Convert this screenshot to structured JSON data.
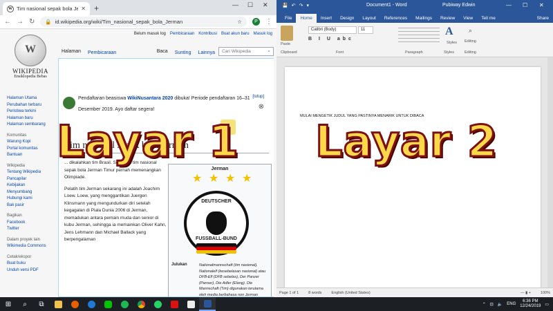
{
  "chrome": {
    "tab_title": "Tim nasional sepak bola Jerman",
    "address": "id.wikipedia.org/wiki/Tim_nasional_sepak_bola_Jerman",
    "avatar_letter": "P"
  },
  "wiki": {
    "wordmark": "WIKIPEDIA",
    "tagline": "Ensiklopedia Bebas",
    "user_links": [
      "Belum masuk log",
      "Pembicaraan",
      "Kontribusi",
      "Buat akun baru",
      "Masuk log"
    ],
    "tabs": [
      "Halaman",
      "Pembicaraan",
      "Baca",
      "Sunting",
      "Lainnya"
    ],
    "search_placeholder": "Cari Wikipedia",
    "sidebar_main": [
      "Halaman Utama",
      "Perubahan terbaru",
      "Peristiwa terkini",
      "Halaman baru",
      "Halaman sembarang"
    ],
    "sidebar_h_community": "Komunitas",
    "sidebar_community": [
      "Warung Kopi",
      "Portal komunitas",
      "Bantuan"
    ],
    "sidebar_h_wikipedia": "Wikipedia",
    "sidebar_wikipedia": [
      "Tentang Wikipedia",
      "Pancapilar",
      "Kebijakan",
      "Menyumbang",
      "Hubungi kami",
      "Bak pasir"
    ],
    "sidebar_h_share": "Bagikan",
    "sidebar_share": [
      "Facebook",
      "Twitter"
    ],
    "sidebar_h_other": "Dalam proyek lain",
    "sidebar_other": [
      "Wikimedia Commons"
    ],
    "sidebar_h_print": "Cetak/ekspor",
    "sidebar_print": [
      "Buat buku",
      "Unduh versi PDF"
    ],
    "notice_close": "[tutup]",
    "notice_pre": "Pendaftaran beasiswa ",
    "notice_bold": "WikiNusantara 2020",
    "notice_post": " dibuka! Periode pendaftaran 16–31 Desember 2019. Ayo daftar segera!",
    "article_title": "Tim nasional sepak bola Jerman",
    "body_p1": "... dikalahkan tim Brasil. Selain itu tim nasional sepak bola Jerman Timur pernah memenangkan Olimpiade.",
    "body_p2": "Pelatih tim Jerman sekarang ini adalah Joachim Loew. Loew, yang menggantikan Juergen Klinsmann yang mengundurkan diri setelah kegagalan di Piala Dunia 2006 di Jerman, memadukan antara pemain muda dan senior di kubu Jerman, sehingga ia memainkan Oliver Kahn, Jens Lehmann dan Michael Ballack yang berpengalaman",
    "infobox_title": "Jerman",
    "crest_top": "DEUTSCHER",
    "crest_bottom": "FUSSBALL-BUND",
    "julukan_key": "Julukan",
    "julukan_value": "Nationalmannschaft (tim nasional), Nationalelf (kesebelasan nasional) atau DFB-Elf (DFB sebelas), Der Panzer (Panser), Die Adler (Elang). Die Mannschaft (Tim) digunakan terutama oleh media berbahasa non Jerman"
  },
  "word": {
    "doc_name": "Document1 - Word",
    "user_name": "Pubiway Edwin",
    "tabs": [
      "File",
      "Home",
      "Insert",
      "Design",
      "Layout",
      "References",
      "Mailings",
      "Review",
      "View",
      "Tell me",
      "Share"
    ],
    "font_name": "Calibri (Body)",
    "font_size": "11",
    "group_labels": [
      "Clipboard",
      "Font",
      "Paragraph",
      "Styles",
      "Editing"
    ],
    "paste_label": "Paste",
    "styles_label": "Styles",
    "editing_label": "Editing",
    "doc_text": "MULAI MENGETIK JUDUL YANG PASTINYA MENARIK UNTUK DIBACA",
    "status_page": "Page 1 of 1",
    "status_words": "8 words",
    "status_lang": "English (United States)",
    "zoom": "100%"
  },
  "captions": {
    "left": "Layar 1",
    "right": "Layar 2"
  },
  "taskbar": {
    "lang": "ENG",
    "time": "6:36 PM",
    "date": "12/24/2019"
  }
}
